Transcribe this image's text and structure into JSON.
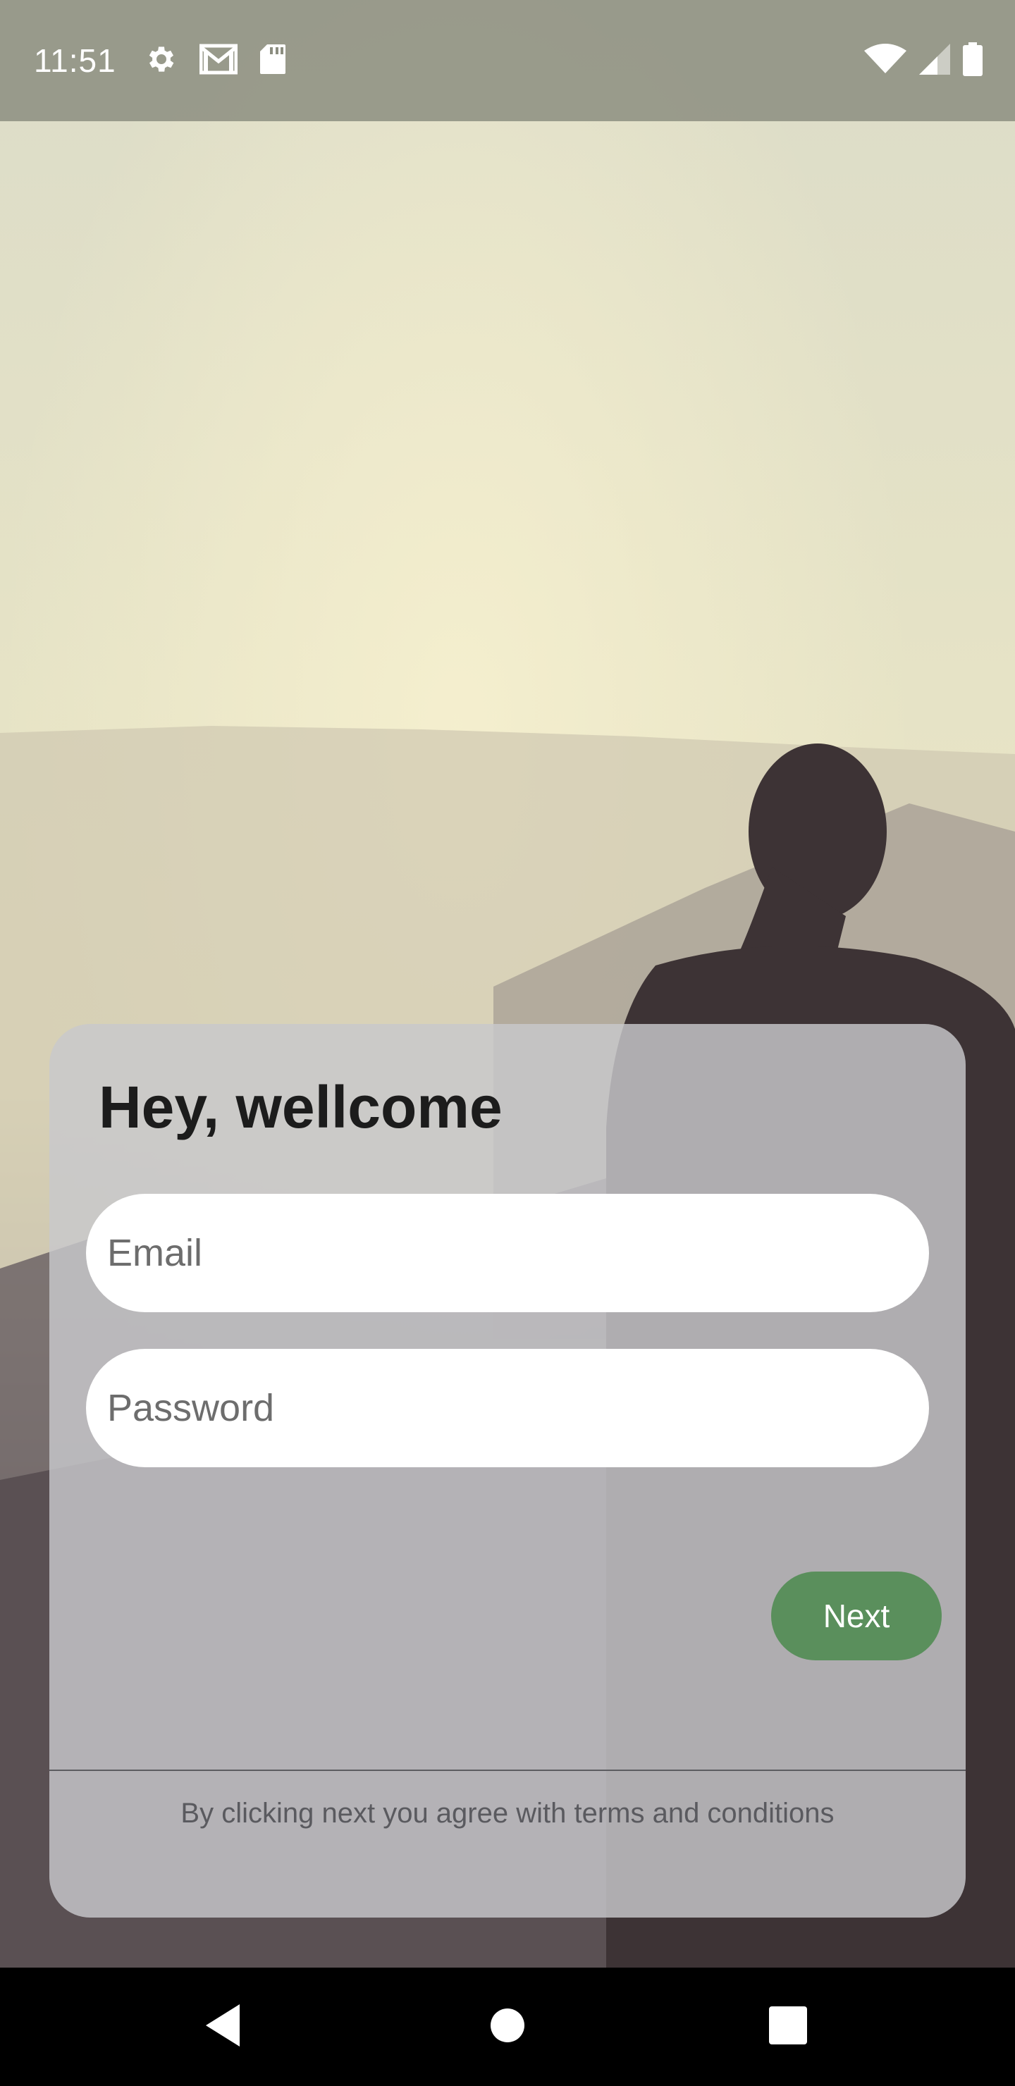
{
  "status_bar": {
    "time": "11:51",
    "left_icons": [
      "gear-icon",
      "gmail-icon",
      "sd-card-icon"
    ],
    "right_icons": [
      "wifi-icon",
      "cell-signal-icon",
      "battery-icon"
    ]
  },
  "login_card": {
    "title": "Hey, wellcome",
    "email_placeholder": "Email",
    "password_placeholder": "Password",
    "next_label": "Next",
    "terms_text": "By clicking next you agree with terms and conditions"
  },
  "nav_bar": {
    "buttons": [
      "back-icon",
      "home-icon",
      "recents-icon"
    ]
  },
  "colors": {
    "next_button": "#5a8f5c",
    "card": "#c8c8cc",
    "title_text": "#1c1c1c"
  }
}
